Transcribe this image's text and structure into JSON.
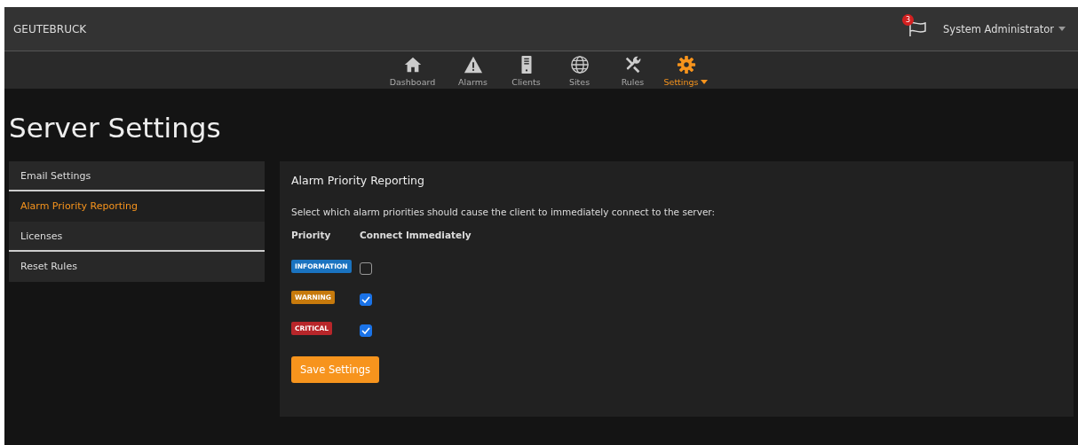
{
  "brand": "GEUTEBRUCK",
  "notifications": {
    "count": "3"
  },
  "user": {
    "name": "System Administrator"
  },
  "nav": [
    {
      "label": "Dashboard",
      "kind": "house",
      "selected": false,
      "dropdown": false
    },
    {
      "label": "Alarms",
      "kind": "warning",
      "selected": false,
      "dropdown": false
    },
    {
      "label": "Clients",
      "kind": "tower",
      "selected": false,
      "dropdown": false
    },
    {
      "label": "Sites",
      "kind": "globe",
      "selected": false,
      "dropdown": false
    },
    {
      "label": "Rules",
      "kind": "tools",
      "selected": false,
      "dropdown": false
    },
    {
      "label": "Settings",
      "kind": "gear",
      "selected": true,
      "dropdown": true
    }
  ],
  "page_title": "Server Settings",
  "sidebar": {
    "items": [
      {
        "label": "Email Settings",
        "selected": false
      },
      {
        "label": "Alarm Priority Reporting",
        "selected": true
      },
      {
        "label": "Licenses",
        "selected": false
      },
      {
        "label": "Reset Rules",
        "selected": false
      }
    ]
  },
  "panel": {
    "title": "Alarm Priority Reporting",
    "description": "Select which alarm priorities should cause the client to immediately connect to the server:",
    "columns": [
      "Priority",
      "Connect Immediately"
    ],
    "rows": [
      {
        "priority": "INFORMATION",
        "color": "#1a73c0",
        "checked": false
      },
      {
        "priority": "WARNING",
        "color": "#c77a0c",
        "checked": true
      },
      {
        "priority": "CRITICAL",
        "color": "#b8262a",
        "checked": true
      }
    ],
    "save_button": "Save Settings"
  }
}
